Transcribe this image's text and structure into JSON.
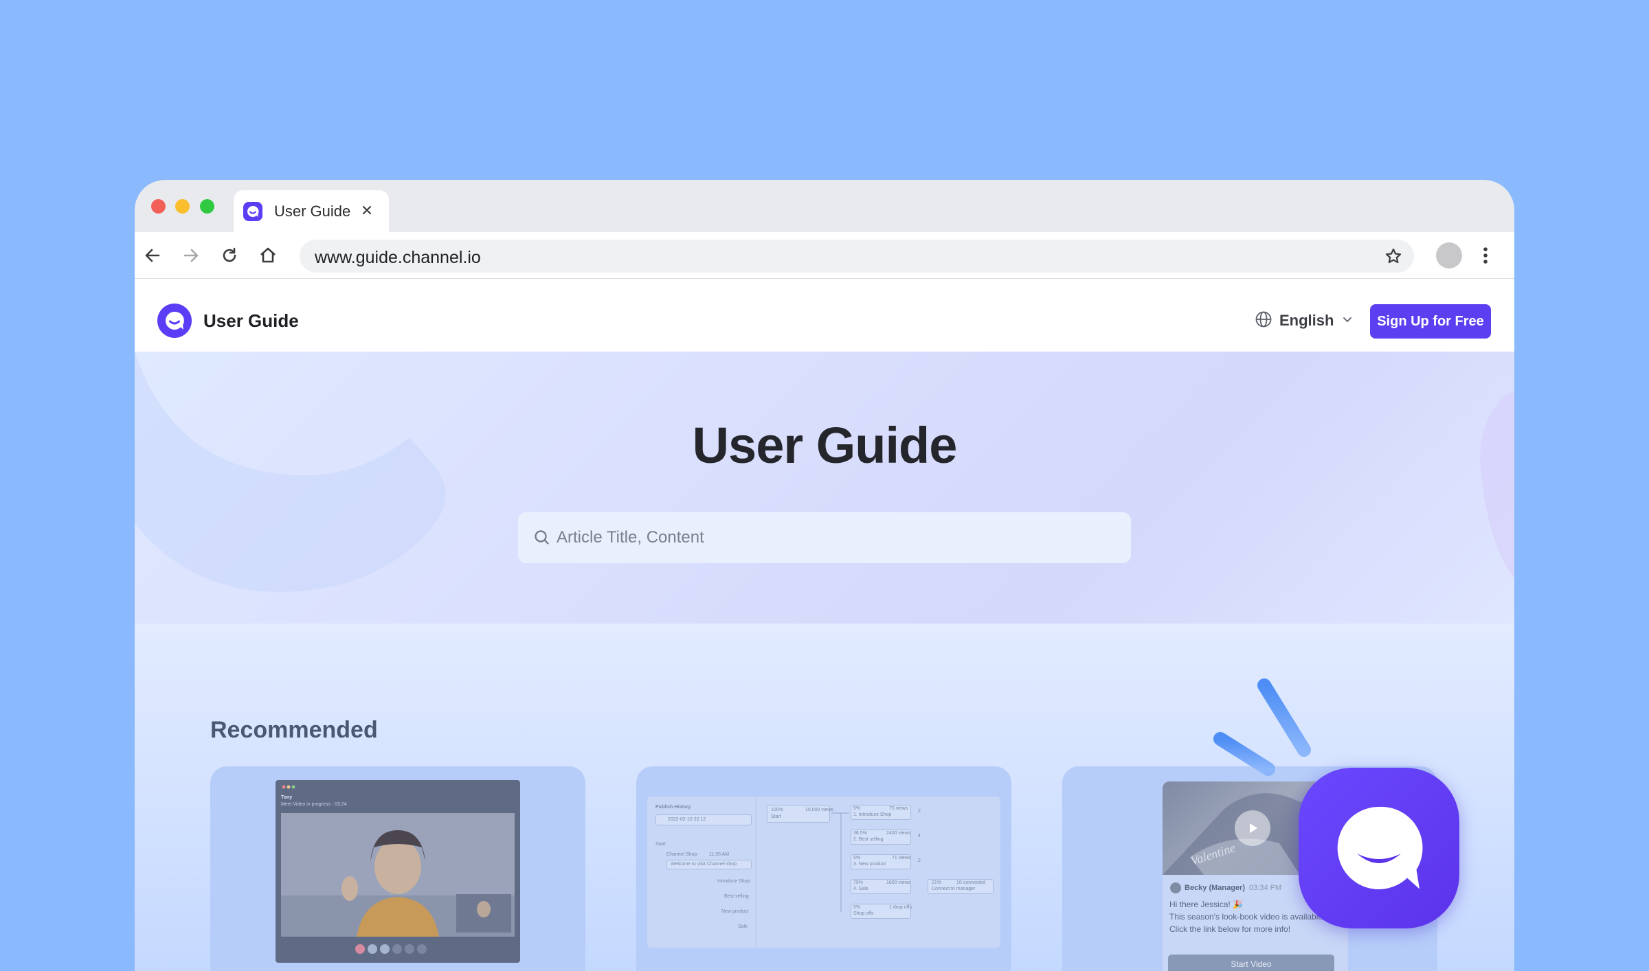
{
  "browser": {
    "tab_title": "User Guide",
    "url": "www.guide.channel.io"
  },
  "header": {
    "title": "User Guide",
    "language": "English",
    "signup_label": "Sign Up for Free"
  },
  "hero": {
    "title": "User Guide",
    "search_placeholder": "Article Title, Content"
  },
  "recommended": {
    "title": "Recommended",
    "card1": {
      "caller_name": "Tony",
      "caller_sub": "Meet Video in progress · 03:24"
    },
    "card2": {
      "panel_title": "Publish History",
      "date": "2022-02-10 22:12",
      "start_label": "Start",
      "sender": "Channel Shop",
      "sender_time": "11:35 AM",
      "welcome": "Welcome to visit Channel shop",
      "options": [
        "Introduce Shop",
        "Best selling",
        "New product",
        "Sale"
      ],
      "flow_start": "Start",
      "flow_start_pct": "100%",
      "flow_start_views": "10,000 views",
      "flow_nodes": [
        {
          "pct": "5%",
          "label": "1. Introduce Shop",
          "views": "75 views"
        },
        {
          "pct": "38.5%",
          "label": "2. Best selling",
          "views": "2400 views"
        },
        {
          "pct": "5%",
          "label": "3. New product",
          "views": "71 views"
        },
        {
          "pct": "79%",
          "label": "4. Sale",
          "views": "1600 views"
        },
        {
          "pct": "5%",
          "label": "Shop offs",
          "views": "1 drop offs"
        }
      ],
      "connect_pct": "21%",
      "connect_label": "Connect to manager",
      "connect_count": "10 connected",
      "counts": [
        "2",
        "4",
        "2"
      ]
    },
    "card3": {
      "sender": "Becky (Manager)",
      "time": "03:34 PM",
      "lines": [
        "Hi there Jessica! 🎉",
        "This season's look-book video is available",
        "Click the link below for more info!"
      ],
      "button": "Start Video",
      "overlay_text": "Valentine"
    }
  },
  "colors": {
    "brand": "#5b3df5",
    "button": "#5d3ff2",
    "background": "#8bb9fd"
  },
  "icons": [
    "back-arrow-icon",
    "forward-arrow-icon",
    "reload-icon",
    "home-icon",
    "star-icon",
    "kebab-icon",
    "globe-icon",
    "chevron-down-icon",
    "search-icon",
    "close-icon",
    "channel-logo-icon",
    "play-icon"
  ]
}
